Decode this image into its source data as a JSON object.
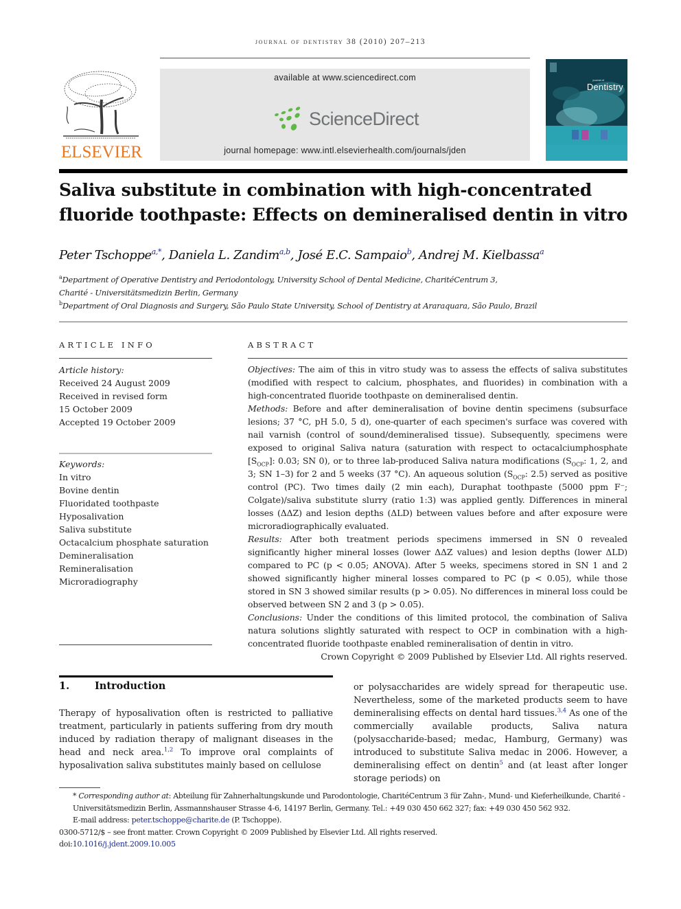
{
  "running_head": "journal of dentistry 38 (2010) 207–213",
  "publisher": {
    "name": "ELSEVIER",
    "brand_color": "#e87722"
  },
  "sciencedirect": {
    "available_text": "available at www.sciencedirect.com",
    "logo_text": "ScienceDirect",
    "logo_dot_color": "#5db846",
    "logo_text_color": "#6f7274",
    "homepage_text": "journal homepage: www.intl.elsevierhealth.com/journals/jden"
  },
  "cover": {
    "title": "Dentistry",
    "subtitle": "journal of"
  },
  "article": {
    "title_line1": "Saliva substitute in combination with high-concentrated",
    "title_line2": "fluoride toothpaste: Effects on demineralised dentin in vitro",
    "authors": [
      {
        "name": "Peter Tschoppe",
        "sup": "a,*"
      },
      {
        "name": "Daniela L. Zandim",
        "sup": "a,b"
      },
      {
        "name": "José E.C. Sampaio",
        "sup": "b"
      },
      {
        "name": "Andrej M. Kielbassa",
        "sup": "a"
      }
    ],
    "affiliations": [
      {
        "key": "a",
        "line1": "Department of Operative Dentistry and Periodontology, University School of Dental Medicine, CharitéCentrum 3,",
        "line2": "Charité - Universitätsmedizin Berlin, Germany"
      },
      {
        "key": "b",
        "line1": "Department of Oral Diagnosis and Surgery, São Paulo State University, School of Dentistry at Araraquara, São Paulo, Brazil"
      }
    ]
  },
  "article_info": {
    "label": "ARTICLE INFO",
    "history_heading": "Article history:",
    "history": [
      "Received 24 August 2009",
      "Received in revised form",
      "15 October 2009",
      "Accepted 19 October 2009"
    ],
    "keywords_heading": "Keywords:",
    "keywords": [
      "In vitro",
      "Bovine dentin",
      "Fluoridated toothpaste",
      "Hyposalivation",
      "Saliva substitute",
      "Octacalcium phosphate saturation",
      "Demineralisation",
      "Remineralisation",
      "Microradiography"
    ]
  },
  "abstract": {
    "label": "ABSTRACT",
    "objectives_label": "Objectives:",
    "objectives": "The aim of this in vitro study was to assess the effects of saliva substitutes (modified with respect to calcium, phosphates, and fluorides) in combination with a high-concentrated fluoride toothpaste on demineralised dentin.",
    "methods_label": "Methods:",
    "methods_1": "Before and after demineralisation of bovine dentin specimens (subsurface lesions; 37 °C, pH 5.0, 5 d), one-quarter of each specimen's surface was covered with nail varnish (control of sound/demineralised tissue). Subsequently, specimens were exposed to original Saliva natura (saturation with respect to octacalciumphosphate [S",
    "methods_sub": "OCP",
    "methods_2": "]: 0.03; SN 0), or to three lab-produced Saliva natura modifications (S",
    "methods_3": ": 1, 2, and 3; SN 1–3) for 2 and 5 weeks (37 °C). An aqueous solution (S",
    "methods_4": ": 2.5) served as positive control (PC). Two times daily (2 min each), Duraphat toothpaste (5000 ppm F⁻; Colgate)/saliva substitute slurry (ratio 1:3) was applied gently. Differences in mineral losses (ΔΔZ) and lesion depths (ΔLD) between values before and after exposure were microradiographically evaluated.",
    "results_label": "Results:",
    "results": "After both treatment periods specimens immersed in SN 0 revealed significantly higher mineral losses (lower ΔΔZ values) and lesion depths (lower ΔLD) compared to PC (p < 0.05; ANOVA). After 5 weeks, specimens stored in SN 1 and 2 showed significantly higher mineral losses compared to PC (p < 0.05), while those stored in SN 3 showed similar results (p > 0.05). No differences in mineral loss could be observed between SN 2 and 3 (p > 0.05).",
    "conclusions_label": "Conclusions:",
    "conclusions": "Under the conditions of this limited protocol, the combination of Saliva natura solutions slightly saturated with respect to OCP in combination with a high-concentrated fluoride toothpaste enabled remineralisation of dentin in vitro.",
    "copyright": "Crown Copyright © 2009 Published by Elsevier Ltd. All rights reserved."
  },
  "body": {
    "section_number": "1.",
    "section_title": "Introduction",
    "left_1": "Therapy of hyposalivation often is restricted to palliative treatment, particularly in patients suffering from dry mouth induced by radiation therapy of malignant diseases in the head and neck area.",
    "left_cite": "1,2",
    "left_2": " To improve oral complaints of hyposalivation saliva substitutes mainly based on cellulose",
    "right_1": "or polysaccharides are widely spread for therapeutic use. Nevertheless, some of the marketed products seem to have demineralising effects on dental hard tissues.",
    "right_cite1": "3,4",
    "right_2": " As one of the commercially available products, Saliva natura (polysaccharide-based; medac, Hamburg, Germany) was introduced to substitute Saliva medac in 2006. However, a demineralising effect on dentin",
    "right_cite2": "5",
    "right_3": " and (at least after longer storage periods) on"
  },
  "footnotes": {
    "corr_star": "*",
    "corr_label": "Corresponding author at",
    "corr_text": ": Abteilung für Zahnerhaltungskunde und Parodontologie, CharitéCentrum 3 für Zahn-, Mund- und Kieferheilkunde, Charité - Universitätsmedizin Berlin, Assmannshauser Strasse 4-6, 14197 Berlin, Germany. Tel.: +49 030 450 662 327; fax: +49 030 450 562 932.",
    "email_label": "E-mail address: ",
    "email": "peter.tschoppe@charite.de",
    "email_suffix": " (P. Tschoppe).",
    "issn_line": "0300-5712/$ – see front matter. Crown Copyright © 2009 Published by Elsevier Ltd. All rights reserved.",
    "doi_prefix": "doi:",
    "doi": "10.1016/j.jdent.2009.10.005"
  }
}
